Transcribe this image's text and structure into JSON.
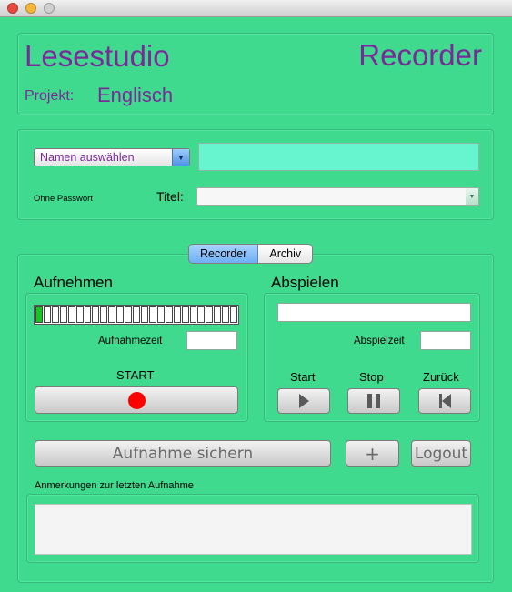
{
  "header": {
    "app_title": "Lesestudio",
    "app_mode": "Recorder",
    "project_label": "Projekt:",
    "project_name": "Englisch"
  },
  "user": {
    "name_select_value": "Namen auswählen",
    "name_field_value": "",
    "password_hint": "Ohne Passwort",
    "title_label": "Titel:",
    "title_value": ""
  },
  "tabs": [
    {
      "label": "Recorder",
      "selected": true
    },
    {
      "label": "Archiv",
      "selected": false
    }
  ],
  "record": {
    "heading": "Aufnehmen",
    "level_meter": {
      "segments": 25,
      "active": 1
    },
    "time_label": "Aufnahmezeit",
    "time_value": "",
    "start_label": "START",
    "record_icon": "record-dot-icon"
  },
  "playback": {
    "heading": "Abspielen",
    "progress_value": "",
    "time_label": "Abspielzeit",
    "time_value": "",
    "play_label": "Start",
    "pause_label": "Stop",
    "back_label": "Zurück"
  },
  "actions": {
    "save_label": "Aufnahme sichern",
    "add_label": "+",
    "logout_label": "Logout"
  },
  "notes": {
    "label": "Anmerkungen zur letzten Aufnahme",
    "value": ""
  },
  "colors": {
    "background": "#3fda8e",
    "title_purple": "#7b2a9a",
    "name_field": "#66f5cf",
    "meter_active": "#14c61d",
    "record_red": "#ff0000"
  }
}
